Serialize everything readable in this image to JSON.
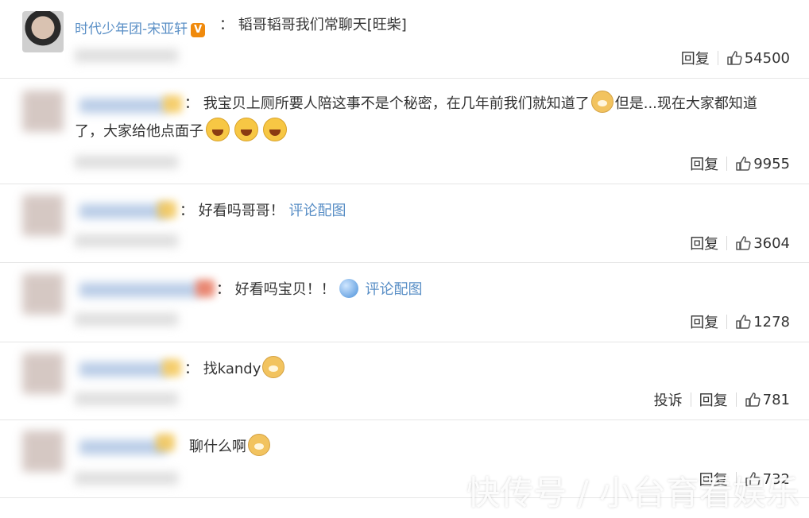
{
  "comments": [
    {
      "author": "时代少年团-宋亚轩",
      "verified_badge": "V",
      "colon": "：",
      "text": "韬哥韬哥我们常聊天[旺柴]",
      "reply_label": "回复",
      "likes": "54500"
    },
    {
      "colon": "：",
      "text_line1": "我宝贝上厕所要人陪这事不是个秘密，在几年前我们就知道了",
      "text_line1b": "但是...现在大家都知道",
      "text_line2": "了，大家给他点面子",
      "reply_label": "回复",
      "likes": "9955"
    },
    {
      "colon": "：",
      "text": "好看吗哥哥！",
      "link": "评论配图",
      "reply_label": "回复",
      "likes": "3604"
    },
    {
      "colon": "：",
      "text": "好看吗宝贝！！",
      "link": "评论配图",
      "reply_label": "回复",
      "likes": "1278"
    },
    {
      "colon": "：",
      "text": "找kandy",
      "report_label": "投诉",
      "reply_label": "回复",
      "likes": "781"
    },
    {
      "text": "聊什么啊",
      "reply_label": "回复",
      "likes": "732"
    }
  ],
  "watermark": "快传号 / 小台育看娱乐",
  "colors": {
    "link": "#5a8fc6",
    "divider": "#e6e6e6",
    "badge": "#f08a0c"
  }
}
